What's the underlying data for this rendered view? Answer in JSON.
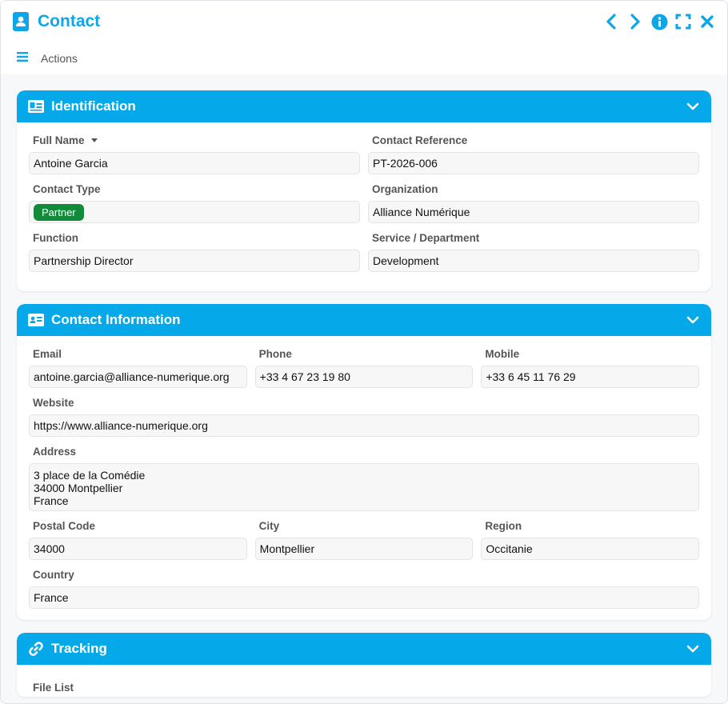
{
  "window": {
    "title": "Contact",
    "colors": {
      "accent": "#05a9ea",
      "badge": "#118a3a"
    }
  },
  "toolbar": {
    "actions_label": "Actions"
  },
  "sections": {
    "identification": {
      "title": "Identification",
      "full_name": {
        "label": "Full Name",
        "value": "Antoine Garcia"
      },
      "contact_reference": {
        "label": "Contact Reference",
        "value": "PT-2026-006"
      },
      "contact_type": {
        "label": "Contact Type",
        "value": "Partner"
      },
      "organization": {
        "label": "Organization",
        "value": "Alliance Numérique"
      },
      "function": {
        "label": "Function",
        "value": "Partnership Director"
      },
      "service": {
        "label": "Service / Department",
        "value": "Development"
      }
    },
    "contact_info": {
      "title": "Contact Information",
      "email": {
        "label": "Email",
        "value": "antoine.garcia@alliance-numerique.org"
      },
      "phone": {
        "label": "Phone",
        "value": "+33 4 67 23 19 80"
      },
      "mobile": {
        "label": "Mobile",
        "value": "+33 6 45 11 76 29"
      },
      "website": {
        "label": "Website",
        "value": "https://www.alliance-numerique.org"
      },
      "address": {
        "label": "Address",
        "lines": [
          "3 place de la Comédie",
          "34000 Montpellier",
          "France"
        ]
      },
      "postal_code": {
        "label": "Postal Code",
        "value": "34000"
      },
      "city": {
        "label": "City",
        "value": "Montpellier"
      },
      "region": {
        "label": "Region",
        "value": "Occitanie"
      },
      "country": {
        "label": "Country",
        "value": "France"
      }
    },
    "tracking": {
      "title": "Tracking",
      "file_list_label": "File List"
    }
  }
}
